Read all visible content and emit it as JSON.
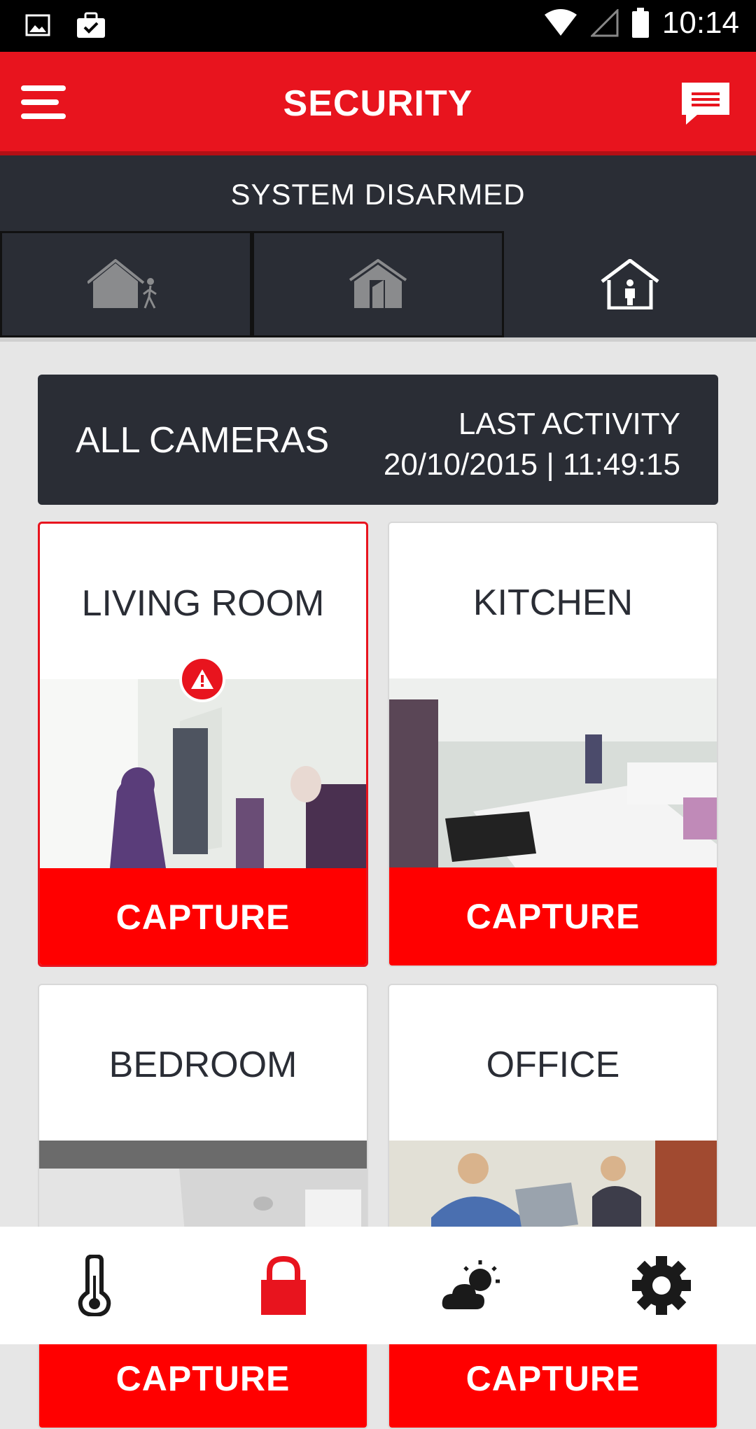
{
  "statusbar": {
    "time": "10:14"
  },
  "header": {
    "title": "SECURITY"
  },
  "arm": {
    "status": "SYSTEM DISARMED",
    "modes": [
      "away",
      "stay",
      "disarmed"
    ],
    "selected": 2
  },
  "cameras": {
    "label": "ALL CAMERAS",
    "last_activity_label": "LAST ACTIVITY",
    "last_activity_value": "20/10/2015 | 11:49:15",
    "items": [
      {
        "name": "LIVING ROOM",
        "action": "CAPTURE",
        "alert": true
      },
      {
        "name": "KITCHEN",
        "action": "CAPTURE",
        "alert": false
      },
      {
        "name": "BEDROOM",
        "action": "CAPTURE",
        "alert": false
      },
      {
        "name": "OFFICE",
        "action": "CAPTURE",
        "alert": false
      }
    ]
  },
  "nav": {
    "items": [
      "thermometer-icon",
      "lock-icon",
      "weather-icon",
      "gear-icon"
    ],
    "active": 1
  },
  "colors": {
    "accent": "#e8141e",
    "dark": "#2a2d35",
    "capture": "#ff0000"
  }
}
